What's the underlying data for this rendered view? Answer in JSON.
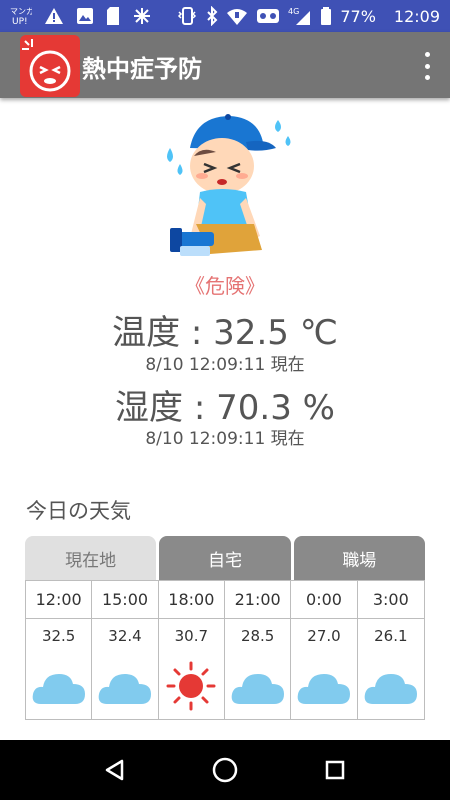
{
  "status_bar": {
    "left_icons": [
      "manga-up-icon",
      "alert-icon",
      "image-icon",
      "sim-card-icon",
      "network-icon"
    ],
    "right_icons": [
      "phone-vibrate-icon",
      "bluetooth-icon",
      "wifi-icon",
      "voicemail-icon",
      "signal-4g-icon"
    ],
    "network_label": "4G",
    "battery": "77%",
    "time": "12:09"
  },
  "app_bar": {
    "title": "熱中症予防"
  },
  "status": {
    "risk_label": "《危険》",
    "temperature_text": "温度 : 32.5 ℃",
    "temperature_time": "8/10 12:09:11 現在",
    "humidity_text": "湿度 : 70.3 %",
    "humidity_time": "8/10 12:09:11 現在"
  },
  "weather": {
    "heading": "今日の天気",
    "tabs": [
      {
        "label": "現在地",
        "active": true
      },
      {
        "label": "自宅",
        "active": false
      },
      {
        "label": "職場",
        "active": false
      }
    ],
    "forecast": [
      {
        "time": "12:00",
        "temp": "32.5",
        "icon": "cloud-icon"
      },
      {
        "time": "15:00",
        "temp": "32.4",
        "icon": "cloud-icon"
      },
      {
        "time": "18:00",
        "temp": "30.7",
        "icon": "sun-icon"
      },
      {
        "time": "21:00",
        "temp": "28.5",
        "icon": "cloud-icon"
      },
      {
        "time": "0:00",
        "temp": "27.0",
        "icon": "cloud-icon"
      },
      {
        "time": "3:00",
        "temp": "26.1",
        "icon": "cloud-icon"
      }
    ]
  },
  "colors": {
    "status_bar": "#3f51b5",
    "app_bar": "#757575",
    "risk": "#e57373",
    "cloud": "#81cbee",
    "sun": "#e53935"
  }
}
